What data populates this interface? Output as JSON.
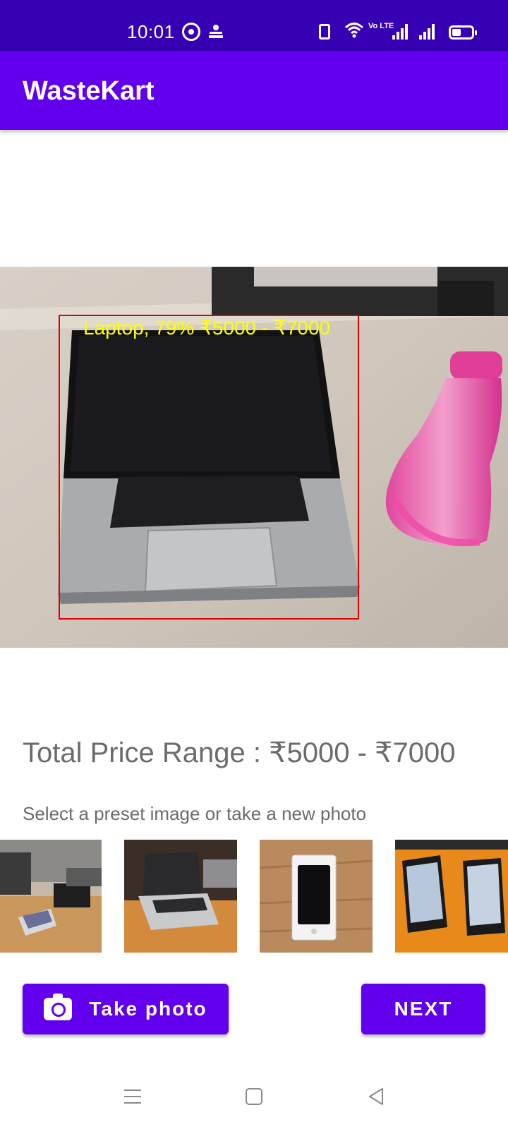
{
  "status_bar": {
    "time": "10:01",
    "icons": [
      "whatsapp-icon",
      "news-icon",
      "vibrate-icon",
      "wifi-icon",
      "volte-icon",
      "signal-icon",
      "signal-icon",
      "battery-icon"
    ],
    "volte_text": "Vo LTE"
  },
  "app_bar": {
    "title": "WasteKart"
  },
  "detection": {
    "label": "Laptop, 79% ₹5000 - ₹7000",
    "box_color": "#e00000",
    "label_color": "#ffff00"
  },
  "price": {
    "text": "Total Price Range : ₹5000 - ₹7000"
  },
  "hint": {
    "text": "Select a preset image or take a new photo"
  },
  "thumbnails": [
    "desk-laptop-photo",
    "laptop-on-table-photo",
    "iphone-box-photo",
    "phones-on-table-photo"
  ],
  "buttons": {
    "take_photo": "Take photo",
    "next": "NEXT"
  },
  "nav_bar": {
    "icons": [
      "menu-icon",
      "home-icon",
      "back-icon"
    ]
  },
  "colors": {
    "primary": "#6200ee",
    "primary_dark": "#3700b3",
    "text_secondary": "#6b6b6b"
  }
}
